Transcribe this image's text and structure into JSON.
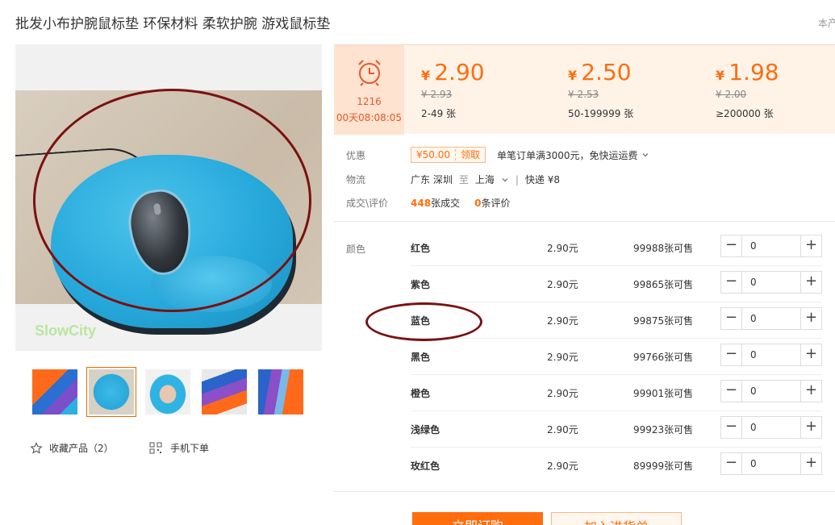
{
  "product": {
    "title": "批发小布护腕鼠标垫 环保材料 柔软护腕 游戏鼠标垫",
    "top_right_text": "本产",
    "watermark": "SlowCity"
  },
  "gallery": {
    "thumbnail_count": 5,
    "selected_index": 1
  },
  "actions": {
    "favorite_label": "收藏产品（2）",
    "mobile_order_label": "手机下单"
  },
  "timer": {
    "count": "1216",
    "remaining": "00天08:08:05"
  },
  "price_tiers": [
    {
      "currency": "¥",
      "price": "2.90",
      "original": "¥ 2.93",
      "range": "2-49 张"
    },
    {
      "currency": "¥",
      "price": "2.50",
      "original": "¥ 2.53",
      "range": "50-199999 张"
    },
    {
      "currency": "¥",
      "price": "1.98",
      "original": "¥ 2.00",
      "range": "≥200000 张"
    }
  ],
  "promo": {
    "label": "优惠",
    "coupon_amount": "¥50.00",
    "coupon_action": "领取",
    "text": "单笔订单满3000元，免快运运费"
  },
  "logistics": {
    "label": "物流",
    "from": "广东 深圳",
    "to_word": "至",
    "to": "上海",
    "separator": "|",
    "method": "快递 ¥8"
  },
  "deals": {
    "label": "成交\\评价",
    "sold_count": "448",
    "sold_unit": "张成交",
    "review_count": "0",
    "review_unit": "条评价"
  },
  "sku": {
    "label": "颜色",
    "rows": [
      {
        "name": "红色",
        "price": "2.90元",
        "stock": "99988张可售",
        "qty": "0"
      },
      {
        "name": "紫色",
        "price": "2.90元",
        "stock": "99865张可售",
        "qty": "0"
      },
      {
        "name": "蓝色",
        "price": "2.90元",
        "stock": "99875张可售",
        "qty": "0"
      },
      {
        "name": "黑色",
        "price": "2.90元",
        "stock": "99766张可售",
        "qty": "0"
      },
      {
        "name": "橙色",
        "price": "2.90元",
        "stock": "99901张可售",
        "qty": "0"
      },
      {
        "name": "浅绿色",
        "price": "2.90元",
        "stock": "99923张可售",
        "qty": "0"
      },
      {
        "name": "玫红色",
        "price": "2.90元",
        "stock": "89999张可售",
        "qty": "0"
      }
    ],
    "minus_symbol": "−",
    "plus_symbol": "+"
  },
  "buttons": {
    "buy_label": "立即订购",
    "cart_label": "加入进货单"
  },
  "colors": {
    "accent": "#ff6d0d",
    "timer_text": "#e4582b",
    "price_bar_bg": "#fff3e8",
    "annotation_ring": "#7a1111"
  }
}
